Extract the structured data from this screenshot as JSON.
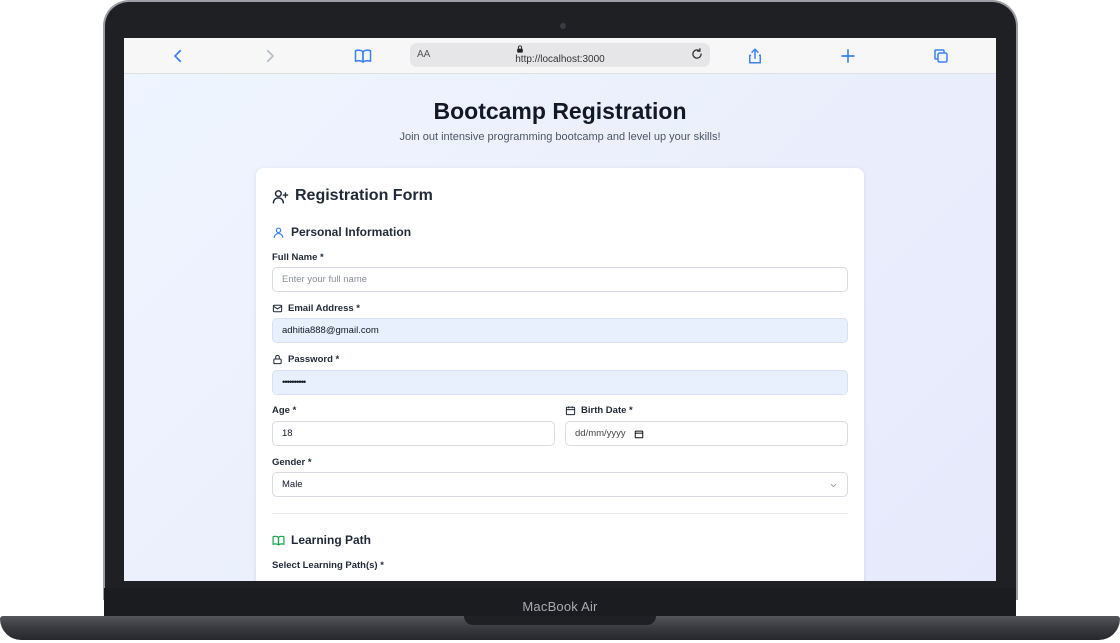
{
  "device": {
    "label": "MacBook Air"
  },
  "browser": {
    "url": "http://localhost:3000",
    "text_size_label": "AA",
    "icons": [
      "back-icon",
      "forward-icon",
      "reader-book-icon",
      "lock-icon",
      "reload-icon",
      "share-icon",
      "new-tab-plus-icon",
      "tabs-icon"
    ]
  },
  "page": {
    "title": "Bootcamp Registration",
    "subtitle": "Join out intensive programming bootcamp and level up your skills!"
  },
  "form": {
    "title": "Registration Form",
    "personal": {
      "section_title": "Personal Information",
      "full_name": {
        "label": "Full Name *",
        "placeholder": "Enter your full name",
        "value": ""
      },
      "email": {
        "label": "Email Address *",
        "value": "adhitia888@gmail.com"
      },
      "password": {
        "label": "Password *",
        "value": "••••••••••"
      },
      "age": {
        "label": "Age *",
        "value": "18"
      },
      "birth_date": {
        "label": "Birth Date *",
        "value": "dd/mm/yyyy"
      },
      "gender": {
        "label": "Gender *",
        "value": "Male"
      }
    },
    "learning": {
      "section_title": "Learning Path",
      "select_label": "Select Learning Path(s) *"
    }
  },
  "colors": {
    "accent_blue": "#3b82f6",
    "accent_green": "#16a34a",
    "autofill_bg": "#e8f0fe",
    "page_bg": "#eef3ff"
  }
}
